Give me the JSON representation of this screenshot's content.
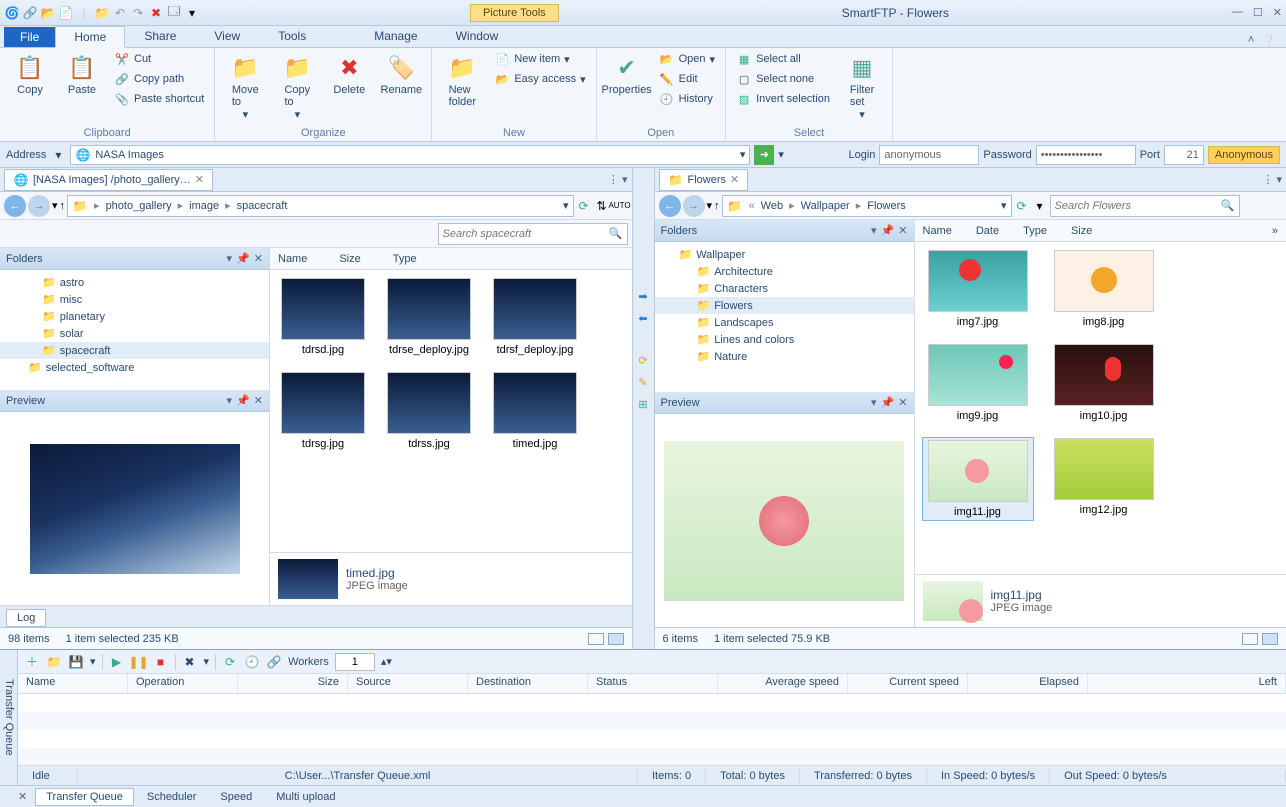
{
  "title": "SmartFTP - Flowers",
  "picture_tools": "Picture Tools",
  "ribbon_tabs": {
    "file": "File",
    "home": "Home",
    "share": "Share",
    "view": "View",
    "tools": "Tools",
    "manage": "Manage",
    "window": "Window"
  },
  "ribbon": {
    "clipboard": {
      "label": "Clipboard",
      "copy": "Copy",
      "paste": "Paste",
      "cut": "Cut",
      "copy_path": "Copy path",
      "paste_shortcut": "Paste shortcut"
    },
    "organize": {
      "label": "Organize",
      "move_to": "Move\nto",
      "copy_to": "Copy\nto",
      "delete": "Delete",
      "rename": "Rename"
    },
    "new": {
      "label": "New",
      "new_folder": "New\nfolder",
      "new_item": "New item",
      "easy_access": "Easy access"
    },
    "open": {
      "label": "Open",
      "properties": "Properties",
      "open": "Open",
      "edit": "Edit",
      "history": "History"
    },
    "select": {
      "label": "Select",
      "select_all": "Select all",
      "select_none": "Select none",
      "invert": "Invert selection",
      "filter_set": "Filter\nset"
    }
  },
  "address": {
    "label": "Address",
    "value": "NASA Images"
  },
  "login": {
    "label": "Login",
    "user": "anonymous",
    "pass_label": "Password",
    "pass_mask": "••••••••••••••••",
    "port_label": "Port",
    "port": "21",
    "anon": "Anonymous"
  },
  "left": {
    "tab": "[NASA Images] /photo_gallery…",
    "crumbs": [
      "photo_gallery",
      "image",
      "spacecraft"
    ],
    "search_ph": "Search spacecraft",
    "folders_label": "Folders",
    "preview_label": "Preview",
    "tree": [
      "astro",
      "misc",
      "planetary",
      "solar",
      "spacecraft",
      "selected_software"
    ],
    "tree_sel": 4,
    "headers": [
      "Name",
      "Size",
      "Type"
    ],
    "files": [
      "tdrsd.jpg",
      "tdrse_deploy.jpg",
      "tdrsf_deploy.jpg",
      "tdrsg.jpg",
      "tdrss.jpg",
      "timed.jpg"
    ],
    "detail": {
      "name": "timed.jpg",
      "type": "JPEG image"
    },
    "log_tab": "Log",
    "status": {
      "items": "98 items",
      "sel": "1 item selected  235 KB"
    }
  },
  "right": {
    "tab": "Flowers",
    "crumbs": [
      "Web",
      "Wallpaper",
      "Flowers"
    ],
    "search_ph": "Search Flowers",
    "folders_label": "Folders",
    "preview_label": "Preview",
    "tree": [
      "Wallpaper",
      "Architecture",
      "Characters",
      "Flowers",
      "Landscapes",
      "Lines and colors",
      "Nature"
    ],
    "tree_sel": 3,
    "headers": [
      "Name",
      "Date",
      "Type",
      "Size"
    ],
    "files": [
      "img7.jpg",
      "img8.jpg",
      "img9.jpg",
      "img10.jpg",
      "img11.jpg",
      "img12.jpg"
    ],
    "sel_index": 4,
    "detail": {
      "name": "img11.jpg",
      "type": "JPEG image"
    },
    "status": {
      "items": "6 items",
      "sel": "1 item selected  75.9 KB"
    }
  },
  "tq": {
    "side": "Transfer Queue",
    "workers_label": "Workers",
    "workers_value": "1",
    "headers": [
      "Name",
      "Operation",
      "Size",
      "Source",
      "Destination",
      "Status",
      "Average speed",
      "Current speed",
      "Elapsed",
      "Left"
    ],
    "status": {
      "idle": "Idle",
      "path": "C:\\User...\\Transfer Queue.xml",
      "items": "Items: 0",
      "total": "Total: 0 bytes",
      "transferred": "Transferred: 0 bytes",
      "in": "In Speed: 0 bytes/s",
      "out": "Out Speed: 0 bytes/s"
    },
    "tabs": [
      "Transfer Queue",
      "Scheduler",
      "Speed",
      "Multi upload"
    ]
  }
}
